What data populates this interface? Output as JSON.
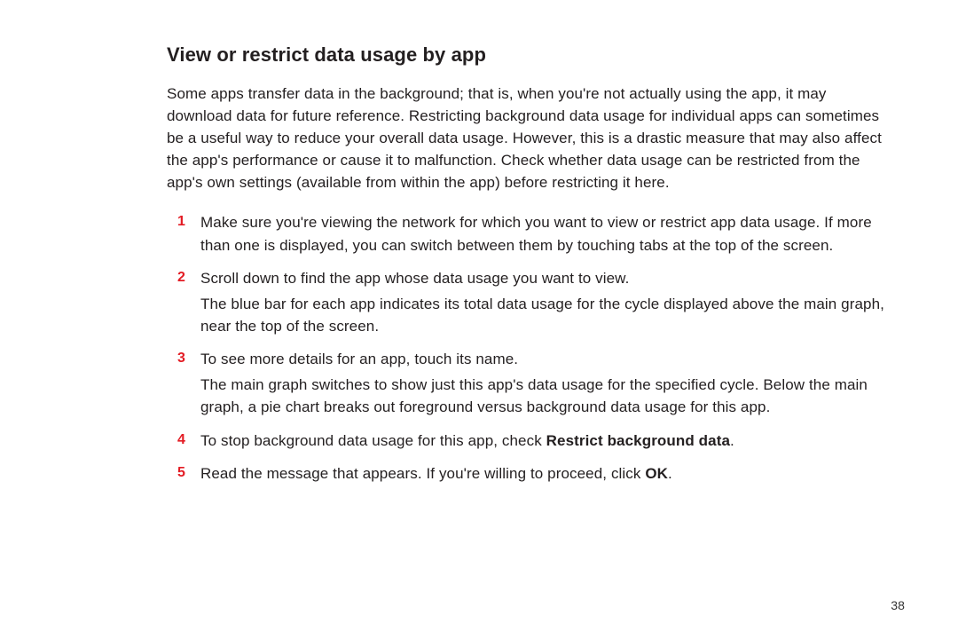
{
  "title": "View or restrict data usage by app",
  "intro": "Some apps transfer data in the background; that is, when you're not actually using the app, it may download data for future reference. Restricting background data usage for individual apps can sometimes be a useful way to reduce your overall data usage. However, this is a drastic measure that may also affect the app's performance or cause it to malfunction. Check whether data usage can be restricted from the app's own settings (available from within the app) before restricting it here.",
  "steps": {
    "s1": {
      "num": "1",
      "p1": "Make sure you're viewing the network for which you want to view or restrict app data usage. If more than one is displayed, you can switch between them by touching tabs at the top of the screen."
    },
    "s2": {
      "num": "2",
      "p1": "Scroll down to find the app whose data usage you want to view.",
      "p2": "The blue bar for each app indicates its total data usage for the cycle displayed above the main graph, near the top of the screen."
    },
    "s3": {
      "num": "3",
      "p1": "To see more details for an app, touch its name.",
      "p2": "The main graph switches to show just this app's data usage for the specified cycle. Below the main graph, a pie chart breaks out foreground versus background data usage for this app."
    },
    "s4": {
      "num": "4",
      "p1_pre": "To stop background data usage for this app, check ",
      "p1_bold": "Restrict background data",
      "p1_post": "."
    },
    "s5": {
      "num": "5",
      "p1_pre": "Read the message that appears. If you're willing to proceed, click ",
      "p1_bold": "OK",
      "p1_post": "."
    }
  },
  "page_number": "38"
}
